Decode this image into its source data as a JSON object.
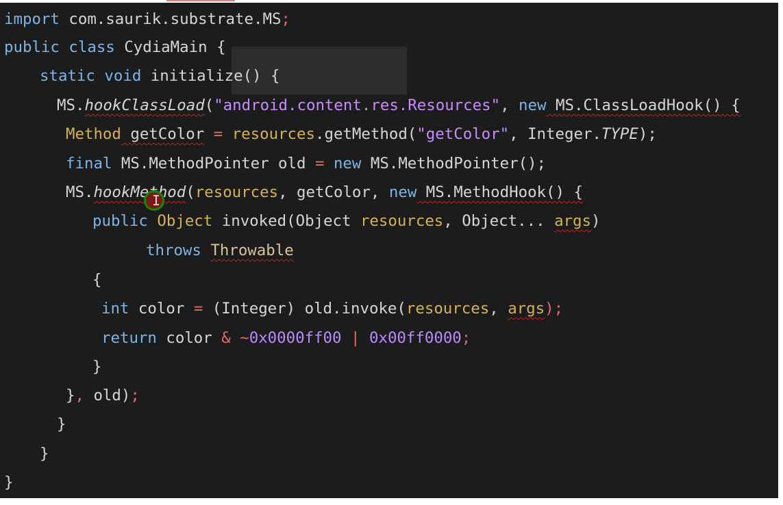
{
  "editor": {
    "theme": {
      "background": "#1c1c1c",
      "default": "#d6d6d6",
      "keyword": "#7fb4e6",
      "operator": "#e06c6c",
      "string": "#c78cff",
      "number": "#b98cff"
    },
    "lines": [
      {
        "tokens": [
          {
            "t": "import",
            "c": "k"
          },
          {
            "t": " com.saurik.substrate.MS"
          },
          {
            "t": ";",
            "c": "o"
          }
        ]
      },
      {
        "tokens": [
          {
            "t": "public",
            "c": "k"
          },
          {
            "t": " "
          },
          {
            "t": "class",
            "c": "k"
          },
          {
            "t": " CydiaMain {"
          }
        ]
      },
      {
        "tokens": [
          {
            "t": "static",
            "c": "k"
          },
          {
            "t": " "
          },
          {
            "t": "void",
            "c": "k"
          },
          {
            "t": " initialize() {"
          }
        ]
      },
      {
        "tokens": [
          {
            "t": "MS."
          },
          {
            "t": "hookClassLoad",
            "c": "i",
            "w": true
          },
          {
            "t": "("
          },
          {
            "t": "\"android.content.res.Resources\"",
            "c": "s"
          },
          {
            "t": ","
          },
          {
            "t": " "
          },
          {
            "t": "new",
            "c": "k"
          },
          {
            "t": " MS.ClassLoadHook() {",
            "w": true
          }
        ]
      },
      {
        "tokens": [
          {
            "t": "Method",
            "c": "yellow"
          },
          {
            "t": " getColor",
            "w": true
          },
          {
            "t": " "
          },
          {
            "t": "=",
            "c": "o"
          },
          {
            "t": " "
          },
          {
            "t": "resources",
            "c": "yellow"
          },
          {
            "t": ".getMethod("
          },
          {
            "t": "\"getColor\"",
            "c": "s"
          },
          {
            "t": ","
          },
          {
            "t": " Integer."
          },
          {
            "t": "TYPE",
            "c": "i"
          },
          {
            "t": ");"
          }
        ]
      },
      {
        "tokens": [
          {
            "t": "final",
            "c": "k"
          },
          {
            "t": " MS.MethodPointer old "
          },
          {
            "t": "=",
            "c": "o"
          },
          {
            "t": " "
          },
          {
            "t": "new",
            "c": "k"
          },
          {
            "t": " MS.MethodPointer();"
          }
        ]
      },
      {
        "tokens": [
          {
            "t": "MS."
          },
          {
            "t": "hookMethod",
            "c": "i",
            "w": true
          },
          {
            "t": "("
          },
          {
            "t": "resources",
            "c": "yellow"
          },
          {
            "t": ","
          },
          {
            "t": " getColor,"
          },
          {
            "t": " "
          },
          {
            "t": "new",
            "c": "k"
          },
          {
            "t": " MS.MethodHook() {",
            "w": true
          }
        ]
      },
      {
        "tokens": [
          {
            "t": "public",
            "c": "k"
          },
          {
            "t": " "
          },
          {
            "t": "Object",
            "c": "yellow"
          },
          {
            "t": " invoked(Object "
          },
          {
            "t": "resources",
            "c": "yellow"
          },
          {
            "t": ","
          },
          {
            "t": " Object... "
          },
          {
            "t": "args",
            "c": "yellow",
            "w": true
          },
          {
            "t": ")"
          }
        ]
      },
      {
        "tokens": [
          {
            "t": "throws",
            "c": "k"
          },
          {
            "t": " "
          },
          {
            "t": "Throwable",
            "c": "beige",
            "w": true
          }
        ]
      },
      {
        "tokens": [
          {
            "t": "{"
          }
        ]
      },
      {
        "tokens": [
          {
            "t": "int",
            "c": "k"
          },
          {
            "t": " color "
          },
          {
            "t": "=",
            "c": "o"
          },
          {
            "t": " (Integer) old.invoke("
          },
          {
            "t": "resources",
            "c": "yellow"
          },
          {
            "t": ","
          },
          {
            "t": " "
          },
          {
            "t": "args",
            "c": "yellow",
            "w": true
          },
          {
            "t": ");",
            "c": "o"
          }
        ]
      },
      {
        "tokens": [
          {
            "t": "return",
            "c": "k"
          },
          {
            "t": " color "
          },
          {
            "t": "&",
            "c": "o"
          },
          {
            "t": " "
          },
          {
            "t": "~",
            "c": "o"
          },
          {
            "t": "0x0000ff00",
            "c": "n"
          },
          {
            "t": " "
          },
          {
            "t": "|",
            "c": "o"
          },
          {
            "t": " "
          },
          {
            "t": "0x00ff0000",
            "c": "n"
          },
          {
            "t": ";",
            "c": "o"
          }
        ]
      },
      {
        "tokens": [
          {
            "t": "}"
          }
        ]
      },
      {
        "tokens": [
          {
            "t": "}"
          },
          {
            "t": ",",
            "c": "o"
          },
          {
            "t": " old)"
          },
          {
            "t": ";",
            "c": "o"
          }
        ]
      },
      {
        "tokens": [
          {
            "t": "}"
          }
        ]
      },
      {
        "tokens": [
          {
            "t": "}"
          }
        ]
      },
      {
        "tokens": [
          {
            "t": "}"
          }
        ]
      }
    ]
  },
  "cursor": {
    "icon": "text-cursor-icon",
    "glyph": "I"
  }
}
